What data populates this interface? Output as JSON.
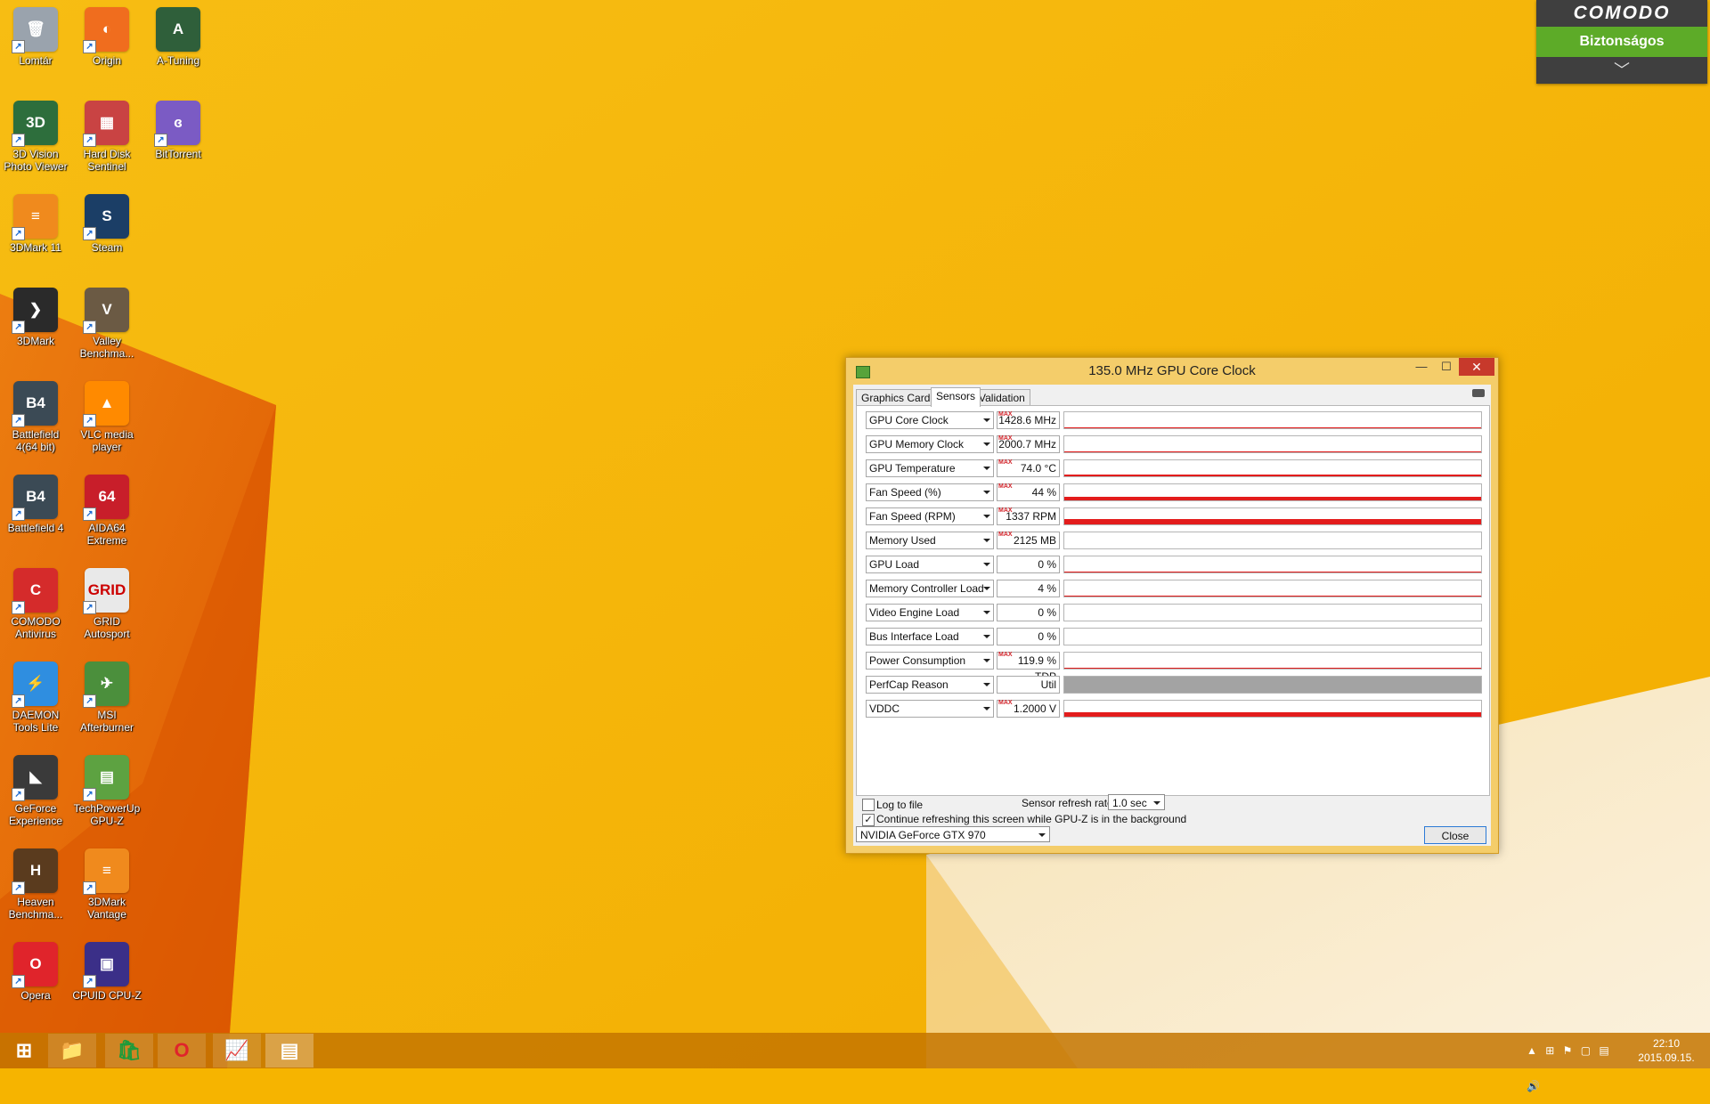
{
  "desktop": {
    "icons": [
      {
        "label": "Lomtár",
        "glyph": "🗑",
        "color": "#9aa3ad",
        "col": 0,
        "row": 0
      },
      {
        "label": "3D Vision\nPhoto Viewer",
        "glyph": "3D",
        "color": "#2d6e3c",
        "col": 0,
        "row": 1
      },
      {
        "label": "3DMark 11",
        "glyph": "≡",
        "color": "#f08a1d",
        "col": 0,
        "row": 2
      },
      {
        "label": "3DMark",
        "glyph": "❯",
        "color": "#2a2a2a",
        "col": 0,
        "row": 3
      },
      {
        "label": "Battlefield\n4(64 bit)",
        "glyph": "B4",
        "color": "#3b4a55",
        "col": 0,
        "row": 4
      },
      {
        "label": "Battlefield 4",
        "glyph": "B4",
        "color": "#3b4a55",
        "col": 0,
        "row": 5
      },
      {
        "label": "COMODO\nAntivirus",
        "glyph": "C",
        "color": "#d52b2b",
        "col": 0,
        "row": 6
      },
      {
        "label": "DAEMON\nTools Lite",
        "glyph": "⚡",
        "color": "#2f8ee0",
        "col": 0,
        "row": 7
      },
      {
        "label": "GeForce\nExperience",
        "glyph": "◣",
        "color": "#3a3a3a",
        "col": 0,
        "row": 8
      },
      {
        "label": "Heaven\nBenchma...",
        "glyph": "H",
        "color": "#5a3b1e",
        "col": 0,
        "row": 9
      },
      {
        "label": "Opera",
        "glyph": "O",
        "color": "#e0242b",
        "col": 0,
        "row": 10
      },
      {
        "label": "Origin",
        "glyph": "◐",
        "color": "#f06d1e",
        "col": 1,
        "row": 0
      },
      {
        "label": "Hard Disk\nSentinel",
        "glyph": "▦",
        "color": "#c94343",
        "col": 1,
        "row": 1
      },
      {
        "label": "Steam",
        "glyph": "S",
        "color": "#1b3e66",
        "col": 1,
        "row": 2
      },
      {
        "label": "Valley\nBenchma...",
        "glyph": "V",
        "color": "#6b5a44",
        "col": 1,
        "row": 3
      },
      {
        "label": "VLC media\nplayer",
        "glyph": "▲",
        "color": "#ff8a00",
        "col": 1,
        "row": 4
      },
      {
        "label": "AIDA64\nExtreme",
        "glyph": "64",
        "color": "#c81e2a",
        "col": 1,
        "row": 5
      },
      {
        "label": "GRID\nAutosport",
        "glyph": "GRID",
        "color": "#e9e9e9",
        "col": 1,
        "row": 6
      },
      {
        "label": "MSI\nAfterburner",
        "glyph": "✈",
        "color": "#4b8f3c",
        "col": 1,
        "row": 7
      },
      {
        "label": "TechPowerUp\nGPU-Z",
        "glyph": "▤",
        "color": "#5da241",
        "col": 1,
        "row": 8
      },
      {
        "label": "3DMark\nVantage",
        "glyph": "≡",
        "color": "#f08a1d",
        "col": 1,
        "row": 9
      },
      {
        "label": "CPUID CPU-Z",
        "glyph": "▣",
        "color": "#3b2f88",
        "col": 1,
        "row": 10
      },
      {
        "label": "A-Tuning",
        "glyph": "A",
        "color": "#2f5f3a",
        "col": 2,
        "row": 0
      },
      {
        "label": "BitTorrent",
        "glyph": "ɞ",
        "color": "#7b5bc4",
        "col": 2,
        "row": 1
      }
    ]
  },
  "comodo": {
    "brand": "COMODO",
    "status": "Biztonságos",
    "expand": "﹀",
    "brand_color": "#3f3f3f",
    "status_color": "#5dab28"
  },
  "gpuz": {
    "title": "135.0 MHz GPU Core Clock",
    "controls": {
      "minimize": "—",
      "maximize": "☐",
      "close": "✕"
    },
    "tabs": [
      {
        "label": "Graphics Card",
        "active": false
      },
      {
        "label": "Sensors",
        "active": true
      },
      {
        "label": "Validation",
        "active": false
      }
    ],
    "sensors": [
      {
        "name": "GPU Core Clock",
        "value": "1428.6 MHz",
        "max": true,
        "level": 0.05
      },
      {
        "name": "GPU Memory Clock",
        "value": "2000.7 MHz",
        "max": true,
        "level": 0.05
      },
      {
        "name": "GPU Temperature",
        "value": "74.0 °C",
        "max": true,
        "level": 0.12
      },
      {
        "name": "Fan Speed (%)",
        "value": "44 %",
        "max": true,
        "level": 0.22
      },
      {
        "name": "Fan Speed (RPM)",
        "value": "1337 RPM",
        "max": true,
        "level": 0.35
      },
      {
        "name": "Memory Used",
        "value": "2125 MB",
        "max": true,
        "level": 0.0
      },
      {
        "name": "GPU Load",
        "value": "0 %",
        "max": false,
        "level": 0.03
      },
      {
        "name": "Memory Controller Load",
        "value": "4 %",
        "max": false,
        "level": 0.04
      },
      {
        "name": "Video Engine Load",
        "value": "0 %",
        "max": false,
        "level": 0.0
      },
      {
        "name": "Bus Interface Load",
        "value": "0 %",
        "max": false,
        "level": 0.0
      },
      {
        "name": "Power Consumption",
        "value": "119.9 % TDP",
        "max": true,
        "level": 0.08
      },
      {
        "name": "PerfCap Reason",
        "value": "Util",
        "max": false,
        "level": 1.0,
        "gray": true
      },
      {
        "name": "VDDC",
        "value": "1.2000 V",
        "max": true,
        "level": 0.25
      }
    ],
    "max_tag": "MAX",
    "log_to_file": {
      "label": "Log to file",
      "checked": false
    },
    "refresh": {
      "label": "Sensor refresh rate:",
      "value": "1.0 sec"
    },
    "background": {
      "label": "Continue refreshing this screen while GPU-Z is in the background",
      "checked": true
    },
    "gpu_select": "NVIDIA GeForce GTX 970",
    "close_button": "Close"
  },
  "taskbar": {
    "items": [
      {
        "name": "start",
        "glyph": "⊞"
      },
      {
        "name": "file-explorer",
        "glyph": "📁"
      },
      {
        "name": "store",
        "glyph": "🛍"
      },
      {
        "name": "opera",
        "glyph": "O"
      },
      {
        "name": "system-monitor",
        "glyph": "📈"
      },
      {
        "name": "gpu-z",
        "glyph": "▤"
      }
    ],
    "tray_glyphs": "▲ ⊞ ⚑ ▢ ▤ 🔊",
    "time": "22:10",
    "date": "2015.09.15."
  },
  "colors": {
    "graph_red": "#e31c1c",
    "accent_blue": "#2c7ad6",
    "wallpaper_yellow": "#f6b400",
    "wallpaper_orange": "#e56400"
  }
}
